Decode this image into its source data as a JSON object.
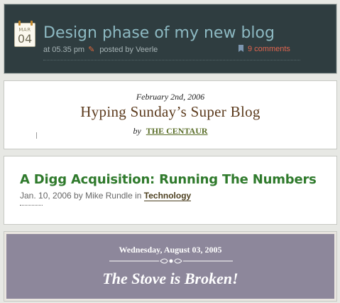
{
  "posts": [
    {
      "calendar": {
        "month": "MAR",
        "day": "04"
      },
      "title": "Design phase of my new blog",
      "time": "at 05.35 pm",
      "posted_by": "posted by Veerle",
      "comments": "9 comments",
      "icons": [
        "calendar-icon",
        "pencil-icon",
        "bookmark-icon"
      ],
      "colors": {
        "background": "#2f3d40",
        "title": "#8db9c2",
        "comments": "#e0654f"
      }
    },
    {
      "date": "February 2nd, 2006",
      "title": "Hyping Sunday’s Super Blog",
      "by": "by",
      "author": "THE CENTAUR",
      "colors": {
        "title": "#5b3a1c",
        "author": "#5b6f2a"
      }
    },
    {
      "title": "A Digg Acquisition: Running The Numbers",
      "meta_prefix": "Jan. 10, 2006 by Mike Rundle in ",
      "category": "Technology",
      "colors": {
        "title": "#2f7a2c"
      }
    },
    {
      "date": "Wednesday, August 03, 2005",
      "title": "The Stove is Broken!",
      "colors": {
        "background": "#8d879b"
      }
    }
  ]
}
